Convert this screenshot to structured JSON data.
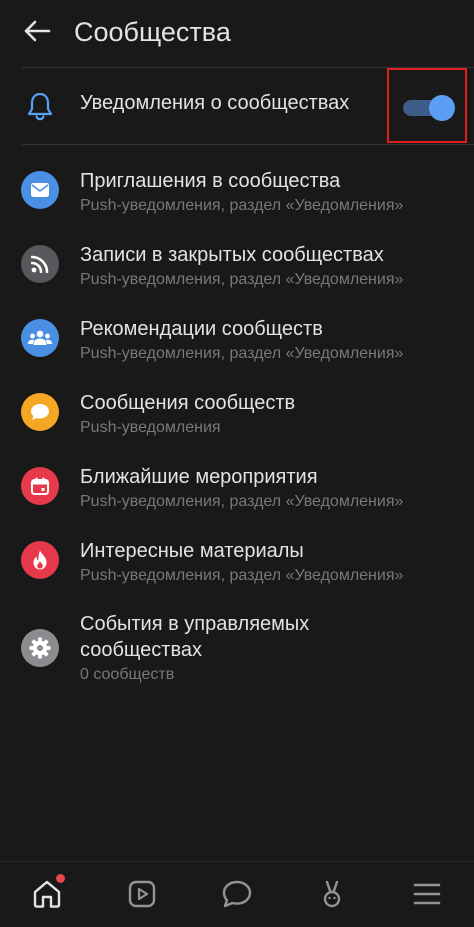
{
  "header": {
    "title": "Сообщества"
  },
  "master": {
    "label": "Уведомления о сообществах",
    "enabled": true
  },
  "colors": {
    "background": "#19191a",
    "accent": "#5a9ff3",
    "highlight_frame": "#e0201f",
    "subtitle": "#76787a"
  },
  "items": [
    {
      "title": "Приглашения в сообщества",
      "subtitle": "Push-уведомления, раздел «Уведомления»",
      "icon": "envelope-icon",
      "color": "#4b8fe2"
    },
    {
      "title": "Записи в закрытых сообществах",
      "subtitle": "Push-уведомления, раздел «Уведомления»",
      "icon": "rss-icon",
      "color": "#58585c"
    },
    {
      "title": "Рекомендации сообществ",
      "subtitle": "Push-уведомления, раздел «Уведомления»",
      "icon": "users-icon",
      "color": "#4b8fe2"
    },
    {
      "title": "Сообщения сообществ",
      "subtitle": "Push-уведомления",
      "icon": "chat-bubble-icon",
      "color": "#f5a623"
    },
    {
      "title": "Ближайшие мероприятия",
      "subtitle": "Push-уведомления, раздел «Уведомления»",
      "icon": "calendar-icon",
      "color": "#e6394a"
    },
    {
      "title": "Интересные материалы",
      "subtitle": "Push-уведомления, раздел «Уведомления»",
      "icon": "flame-icon",
      "color": "#e6394a"
    },
    {
      "title_line1": "События в управляемых",
      "title_line2": "сообществах",
      "subtitle": "0 сообществ",
      "icon": "gear-icon",
      "color": "#8b8d90"
    }
  ],
  "tabbar": {
    "tabs": [
      "home-icon",
      "video-icon",
      "messages-icon",
      "services-icon",
      "menu-icon"
    ],
    "home_has_badge": true
  }
}
